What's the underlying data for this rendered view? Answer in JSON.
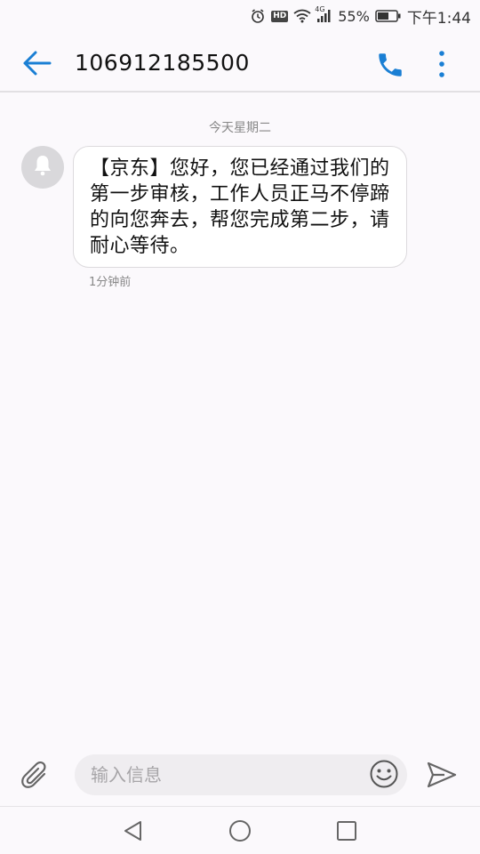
{
  "status_bar": {
    "hd_label": "HD",
    "network_label": "4G",
    "battery_percent": "55%",
    "time": "下午1:44"
  },
  "header": {
    "contact": "106912185500",
    "icons": {
      "back": "arrow-left-icon",
      "call": "phone-icon",
      "more": "more-vertical-icon"
    }
  },
  "conversation": {
    "date_separator": "今天星期二",
    "messages": [
      {
        "text": "【京东】您好，您已经通过我们的第一步审核，工作人员正马不停蹄的向您奔去，帮您完成第二步，请耐心等待。",
        "time": "1分钟前",
        "avatar_icon": "bell-icon"
      }
    ]
  },
  "composer": {
    "placeholder": "输入信息",
    "value": "",
    "icons": {
      "attach": "paperclip-icon",
      "emoji": "smiley-icon",
      "send": "send-icon"
    }
  },
  "colors": {
    "accent": "#1a7fd4",
    "background": "#fbf9fc",
    "bubble": "#ffffff",
    "avatar": "#d9d8db"
  }
}
